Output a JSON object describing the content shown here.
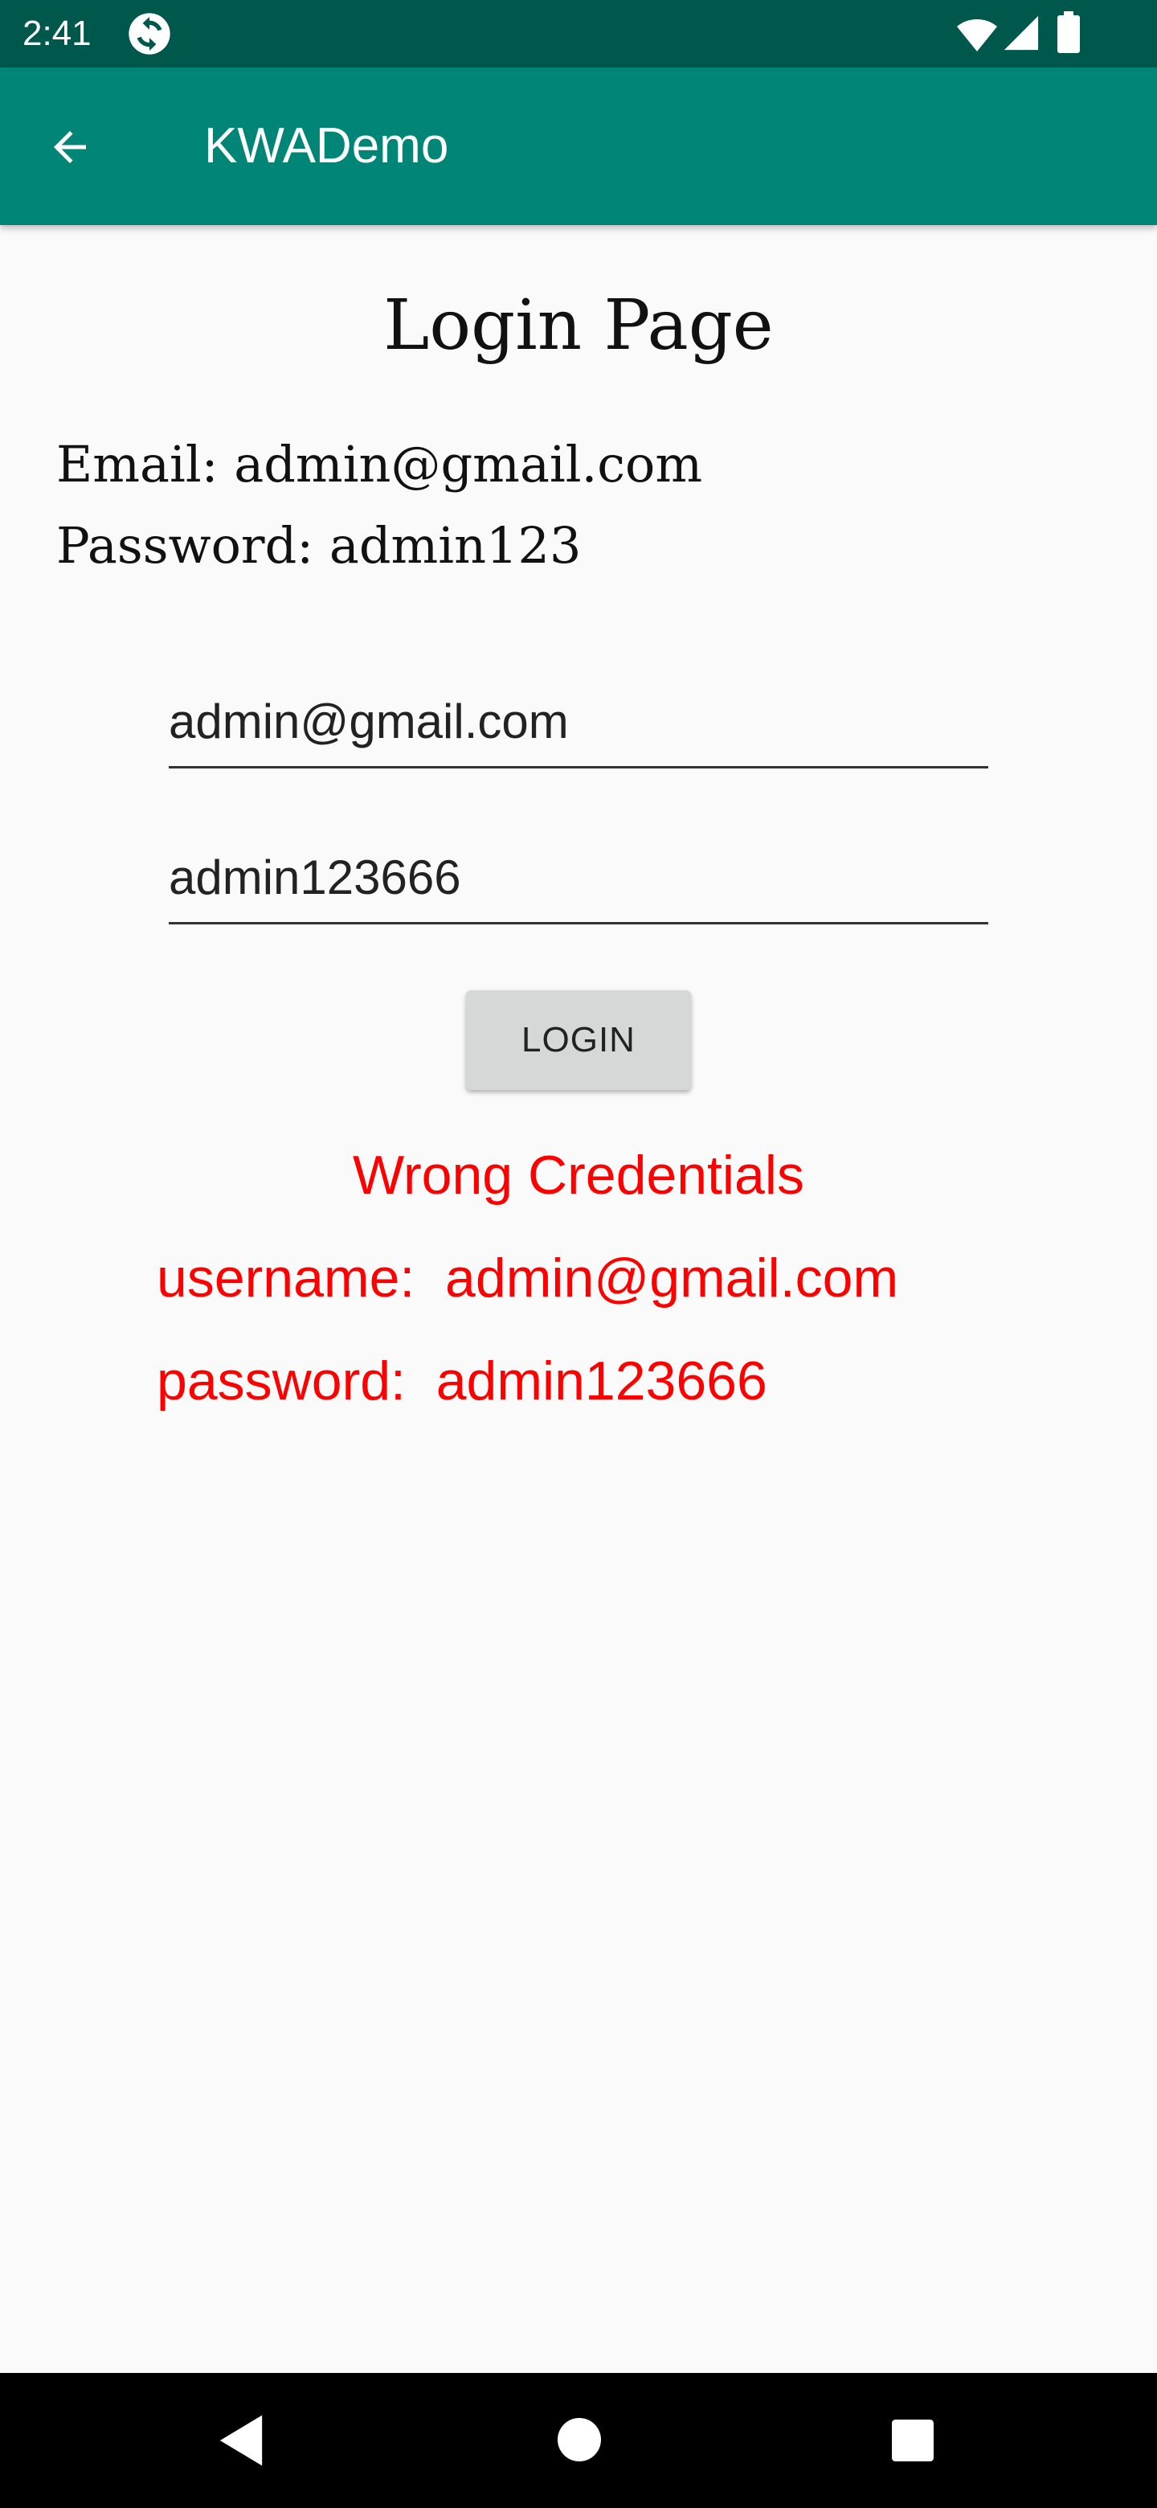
{
  "status_bar": {
    "time": "2:41",
    "icons": [
      "sync-icon",
      "wifi-icon",
      "signal-icon",
      "battery-icon"
    ]
  },
  "app_bar": {
    "title": "KWADemo",
    "back_icon": "arrow-back-icon"
  },
  "main": {
    "page_title": "Login Page",
    "hint_email": "Email: admin@gmail.com",
    "hint_password": "Password: admin123",
    "email_field_value": "admin@gmail.com",
    "password_field_value": "admin123666",
    "login_button": "LOGIN",
    "error_title": "Wrong Credentials",
    "error_username": "username:  admin@gmail.com",
    "error_password": "password:  admin123666"
  },
  "nav_bar": {
    "icons": [
      "nav-back-icon",
      "nav-home-icon",
      "nav-recents-icon"
    ]
  },
  "colors": {
    "status_bar": "#00574b",
    "app_bar": "#008577",
    "error_text": "#ff0000",
    "background": "#fafafa",
    "button": "#d6d7d7"
  }
}
